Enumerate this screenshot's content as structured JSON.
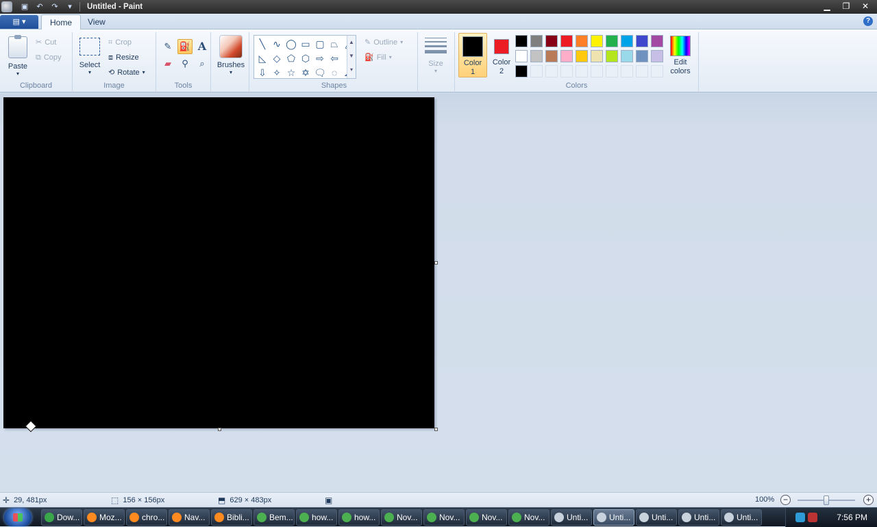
{
  "window": {
    "title": "Untitled - Paint"
  },
  "menu": {
    "file_label": "▤ ▾",
    "tabs": [
      {
        "label": "Home"
      },
      {
        "label": "View"
      }
    ]
  },
  "ribbon": {
    "clipboard": {
      "group_label": "Clipboard",
      "paste_label": "Paste",
      "cut_label": "Cut",
      "copy_label": "Copy"
    },
    "image": {
      "group_label": "Image",
      "select_label": "Select",
      "crop_label": "Crop",
      "resize_label": "Resize",
      "rotate_label": "Rotate"
    },
    "tools": {
      "group_label": "Tools"
    },
    "brushes": {
      "label": "Brushes"
    },
    "shapes": {
      "group_label": "Shapes",
      "outline_label": "Outline",
      "fill_label": "Fill"
    },
    "size": {
      "label": "Size"
    },
    "colors": {
      "group_label": "Colors",
      "color1_label": "Color 1",
      "color2_label": "Color 2",
      "edit_colors_label": "Edit colors",
      "color1_value": "#000000",
      "color2_value": "#ed1c24",
      "palette": [
        "#000000",
        "#7f7f7f",
        "#880015",
        "#ed1c24",
        "#ff7f27",
        "#fff200",
        "#22b14c",
        "#00a2e8",
        "#3f48cc",
        "#a349a4",
        "#ffffff",
        "#c3c3c3",
        "#b97a57",
        "#ffaec9",
        "#ffc90e",
        "#efe4b0",
        "#b5e61d",
        "#99d9ea",
        "#7092be",
        "#c8bfe7",
        "#000000",
        "",
        "",
        "",
        "",
        "",
        "",
        "",
        "",
        ""
      ]
    }
  },
  "canvas": {
    "background": "#000000"
  },
  "status": {
    "cursor_position": "29, 481px",
    "selection_size": "156 × 156px",
    "image_size": "629 × 483px",
    "zoom": "100%"
  },
  "taskbar": {
    "tasks": [
      {
        "label": "Dow...",
        "icon": "download-icon",
        "color": "#3aa84a",
        "active": false
      },
      {
        "label": "Moz...",
        "icon": "firefox-icon",
        "color": "#ff8a1f",
        "active": false
      },
      {
        "label": "chro...",
        "icon": "firefox-icon",
        "color": "#ff8a1f",
        "active": false
      },
      {
        "label": "Nav...",
        "icon": "firefox-icon",
        "color": "#ff8a1f",
        "active": false
      },
      {
        "label": "Bibli...",
        "icon": "firefox-icon",
        "color": "#ff8a1f",
        "active": false
      },
      {
        "label": "Bem...",
        "icon": "chrome-icon",
        "color": "#4caf50",
        "active": false
      },
      {
        "label": "how...",
        "icon": "chrome-icon",
        "color": "#4caf50",
        "active": false
      },
      {
        "label": "how...",
        "icon": "chrome-icon",
        "color": "#4caf50",
        "active": false
      },
      {
        "label": "Nov...",
        "icon": "chrome-icon",
        "color": "#4caf50",
        "active": false
      },
      {
        "label": "Nov...",
        "icon": "chrome-icon",
        "color": "#4caf50",
        "active": false
      },
      {
        "label": "Nov...",
        "icon": "chrome-icon",
        "color": "#4caf50",
        "active": false
      },
      {
        "label": "Nov...",
        "icon": "chrome-icon",
        "color": "#4caf50",
        "active": false
      },
      {
        "label": "Unti...",
        "icon": "paint-icon",
        "color": "#c8d2dc",
        "active": false
      },
      {
        "label": "Unti...",
        "icon": "paint-icon",
        "color": "#c8d2dc",
        "active": true
      },
      {
        "label": "Unti...",
        "icon": "paint-icon",
        "color": "#c8d2dc",
        "active": false
      },
      {
        "label": "Unti...",
        "icon": "paint-icon",
        "color": "#c8d2dc",
        "active": false
      },
      {
        "label": "Unti...",
        "icon": "paint-icon",
        "color": "#c8d2dc",
        "active": false
      }
    ],
    "clock": "7:56 PM"
  }
}
